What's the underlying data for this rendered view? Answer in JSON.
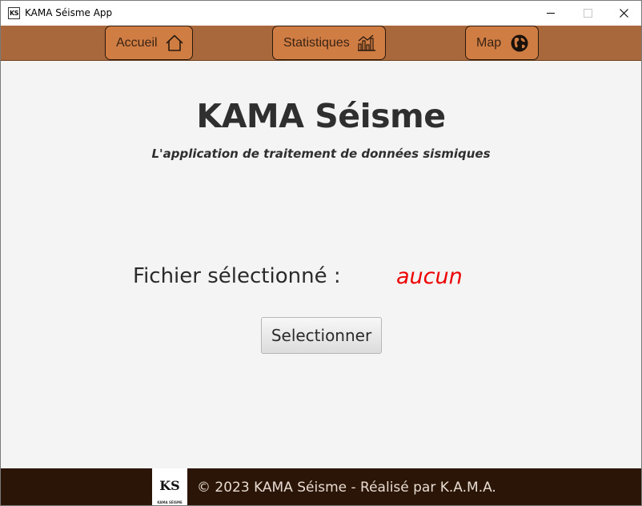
{
  "window": {
    "title": "KAMA Séisme App",
    "icon_text": "KS"
  },
  "nav": {
    "items": [
      {
        "label": "Accueil",
        "icon": "home-icon"
      },
      {
        "label": "Statistiques",
        "icon": "chart-icon"
      },
      {
        "label": "Map",
        "icon": "globe-icon"
      }
    ]
  },
  "main": {
    "title": "KAMA Séisme",
    "subtitle": "L'application de traitement de données sismiques",
    "file_label": "Fichier sélectionné :",
    "file_value": "aucun",
    "select_button": "Selectionner"
  },
  "footer": {
    "logo_text": "KS",
    "logo_subtext": "KAMA SÉISME",
    "text": "© 2023 KAMA Séisme - Réalisé par K.A.M.A."
  },
  "colors": {
    "nav_background": "#a8683c",
    "nav_button": "#d07d44",
    "footer_background": "#2a1507",
    "file_value": "#ee0000"
  }
}
